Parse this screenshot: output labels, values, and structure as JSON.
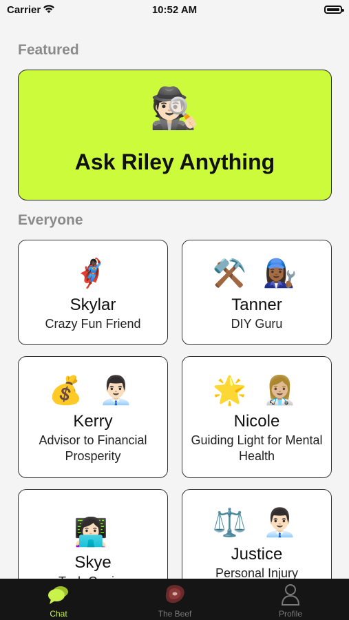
{
  "status_bar": {
    "carrier": "Carrier",
    "time": "10:52 AM"
  },
  "sections": {
    "featured": "Featured",
    "everyone": "Everyone"
  },
  "featured": {
    "emoji": "🕵🏻",
    "title": "Ask Riley Anything",
    "color": "#ccfb3c"
  },
  "people": [
    {
      "emojis": "🦸🏿‍♀️",
      "name": "Skylar",
      "desc": "Crazy Fun Friend"
    },
    {
      "emojis": "⚒️ 👩🏾‍🔧",
      "name": "Tanner",
      "desc": "DIY Guru"
    },
    {
      "emojis": "💰 👨🏻‍💼",
      "name": "Kerry",
      "desc": "Advisor to Financial Prosperity"
    },
    {
      "emojis": "🌟 👩🏼‍⚕️",
      "name": "Nicole",
      "desc": "Guiding Light for Mental Health"
    },
    {
      "emojis": "👩🏻‍💻",
      "name": "Skye",
      "desc": "Tech Genius"
    },
    {
      "emojis": "⚖️ 👨🏻‍💼",
      "name": "Justice",
      "desc": "Personal Injury"
    }
  ],
  "tabs": [
    {
      "label": "Chat",
      "icon": "chat-bubbles-icon",
      "active": true
    },
    {
      "label": "The Beef",
      "icon": "steak-icon",
      "active": false
    },
    {
      "label": "Profile",
      "icon": "person-icon",
      "active": false
    }
  ],
  "colors": {
    "accent": "#c9f24a",
    "tab_bar": "#151515",
    "section_title": "#8a8a8a"
  }
}
